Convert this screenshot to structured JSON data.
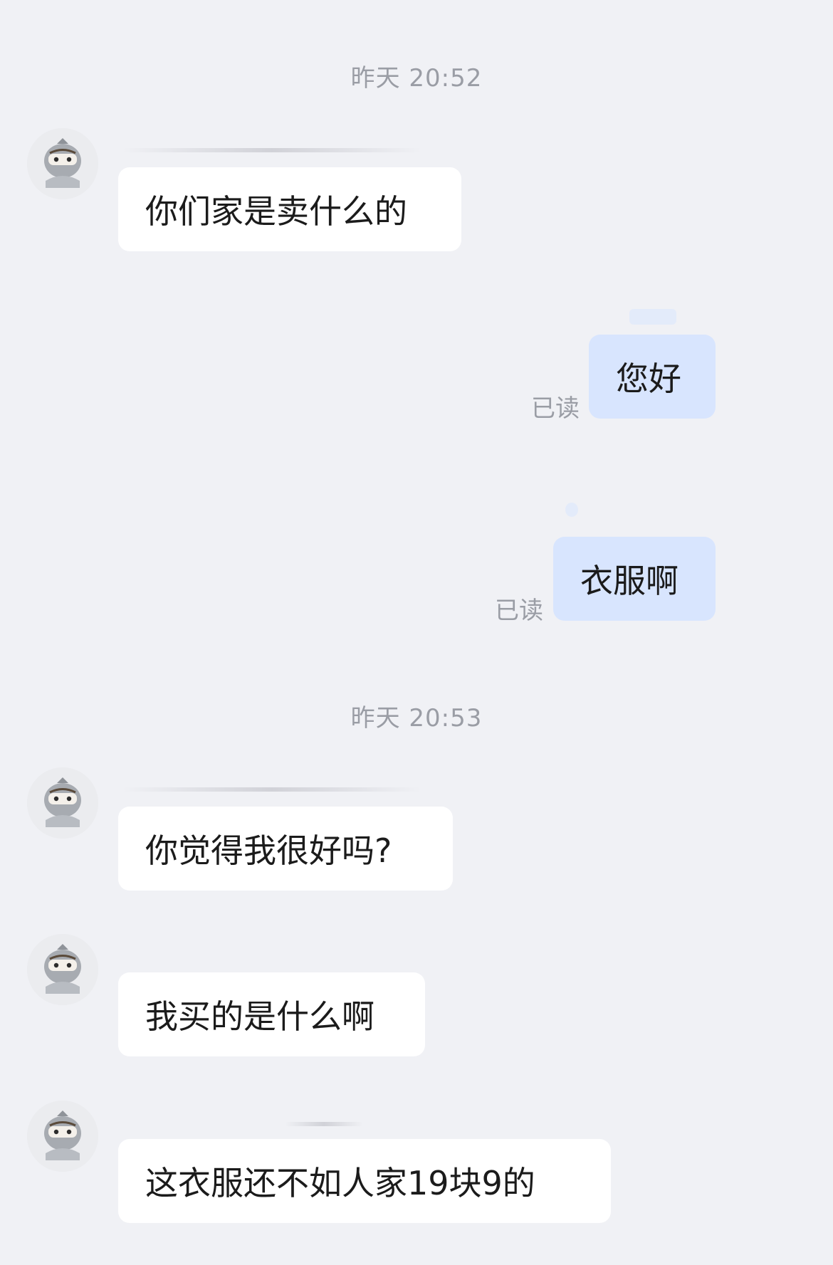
{
  "timestamps": [
    "昨天 20:52",
    "昨天 20:53"
  ],
  "messages": [
    {
      "side": "in",
      "text": "你们家是卖什么的"
    },
    {
      "side": "out",
      "text": "您好",
      "status": "已读"
    },
    {
      "side": "out",
      "text": "衣服啊",
      "status": "已读"
    },
    {
      "side": "in",
      "text": "你觉得我很好吗?"
    },
    {
      "side": "in",
      "text": "我买的是什么啊"
    },
    {
      "side": "in",
      "text": "这衣服还不如人家19块9的"
    }
  ],
  "colors": {
    "background": "#f0f1f5",
    "incoming_bubble": "#ffffff",
    "outgoing_bubble": "#d8e5fe",
    "meta_text": "#9a9da5"
  },
  "icons": {
    "avatar": "ninja-avatar-icon"
  }
}
